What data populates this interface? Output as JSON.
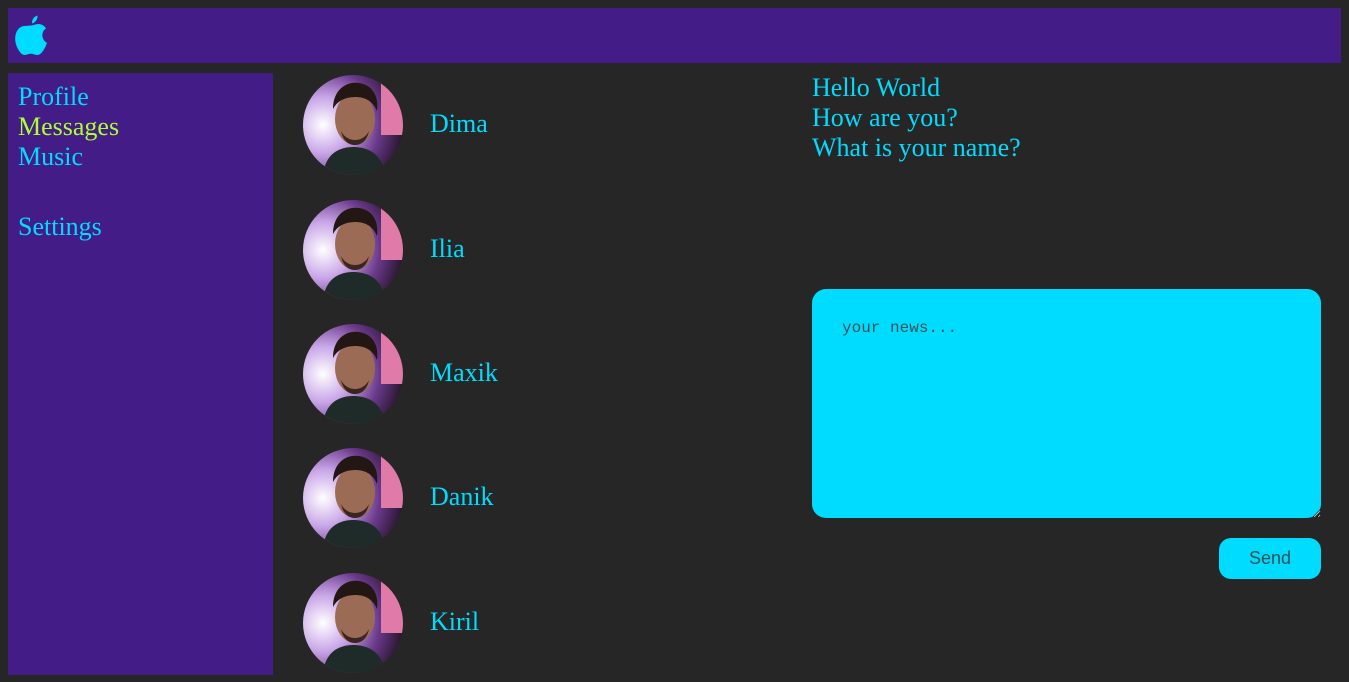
{
  "colors": {
    "background": "#262626",
    "panel": "#441c88",
    "accent": "#00dcff",
    "active": "#adff2f",
    "send_text": "#2f4f55"
  },
  "header": {
    "logo_icon": "apple-logo-icon"
  },
  "sidebar": {
    "items": [
      {
        "label": "Profile",
        "active": false
      },
      {
        "label": "Messages",
        "active": true
      },
      {
        "label": "Music",
        "active": false
      },
      {
        "label": "Settings",
        "active": false
      }
    ]
  },
  "dialogs": [
    {
      "name": "Dima",
      "avatar_icon": "user-avatar-image"
    },
    {
      "name": "Ilia",
      "avatar_icon": "user-avatar-image"
    },
    {
      "name": "Maxik",
      "avatar_icon": "user-avatar-image"
    },
    {
      "name": "Danik",
      "avatar_icon": "user-avatar-image"
    },
    {
      "name": "Kiril",
      "avatar_icon": "user-avatar-image"
    }
  ],
  "messages": [
    "Hello World",
    "How are you?",
    "What is your name?"
  ],
  "composer": {
    "value": "",
    "placeholder": "your news...",
    "send_label": "Send"
  }
}
